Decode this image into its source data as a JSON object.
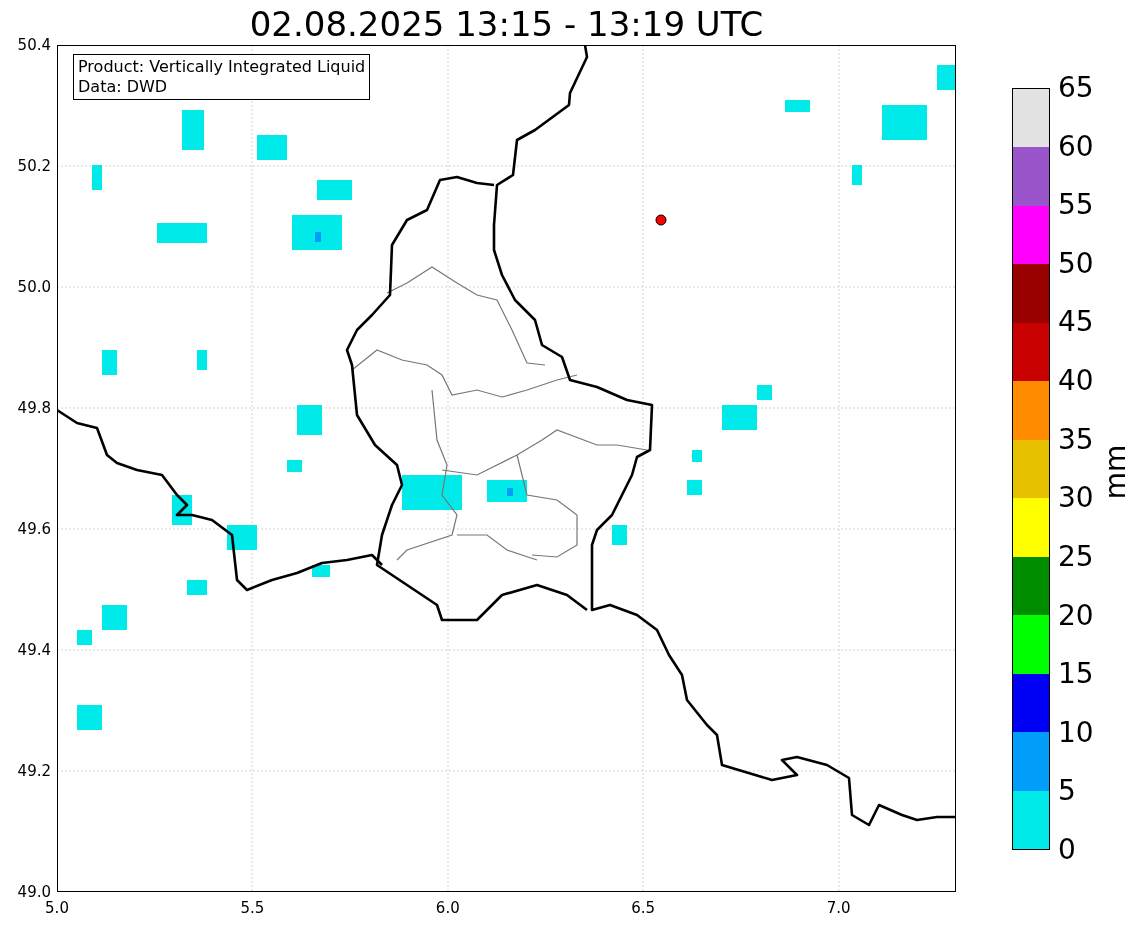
{
  "title": "02.08.2025 13:15 - 13:19 UTC",
  "legend": [
    "Product: Vertically Integrated Liquid",
    "Data: DWD"
  ],
  "x_ticks": [
    "5.0",
    "5.5",
    "6.0",
    "6.5",
    "7.0"
  ],
  "y_ticks": [
    "50.4",
    "50.2",
    "50.0",
    "49.8",
    "49.6",
    "49.4",
    "49.2",
    "49.0"
  ],
  "colorbar": {
    "label": "mm",
    "segments": [
      {
        "color": "#00eaea"
      },
      {
        "color": "#009ef9"
      },
      {
        "color": "#0000f6"
      },
      {
        "color": "#00ff00"
      },
      {
        "color": "#008e00"
      },
      {
        "color": "#ffff00"
      },
      {
        "color": "#e7c000"
      },
      {
        "color": "#ff8c00"
      },
      {
        "color": "#c80000"
      },
      {
        "color": "#990000"
      },
      {
        "color": "#ff00ff"
      },
      {
        "color": "#9955c9"
      },
      {
        "color": "#e2e2e2"
      }
    ],
    "ticks": [
      "65",
      "60",
      "55",
      "50",
      "45",
      "40",
      "35",
      "30",
      "25",
      "20",
      "15",
      "10",
      "5",
      "0"
    ]
  }
}
